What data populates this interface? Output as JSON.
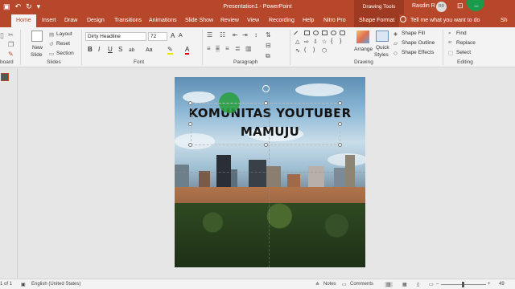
{
  "window": {
    "title": "Presentation1 - PowerPoint",
    "context_label": "Drawing Tools",
    "user_name": "Rasdin R",
    "avatar_initials": "RR",
    "accent": "#b7472a"
  },
  "tabs": [
    "Home",
    "Insert",
    "Draw",
    "Design",
    "Transitions",
    "Animations",
    "Slide Show",
    "Review",
    "View",
    "Recording",
    "Help",
    "Nitro Pro",
    "Shape Format"
  ],
  "tell_me": "Tell me what you want to do",
  "share": "Sh",
  "ribbon": {
    "clipboard_label": "board",
    "slides": {
      "new_slide": "New",
      "new_slide_2": "Slide",
      "layout": "Layout",
      "reset": "Reset",
      "section": "Section",
      "label": "Slides"
    },
    "font": {
      "name": "Dirty Headline",
      "size": "72",
      "label": "Font",
      "bold": "B",
      "italic": "I",
      "underline": "U",
      "strike": "S",
      "spacing": "ab",
      "case": "Aa"
    },
    "paragraph": {
      "label": "Paragraph"
    },
    "drawing": {
      "arrange": "Arrange",
      "quick_styles": "Quick",
      "quick_styles_2": "Styles",
      "shape_fill": "Shape Fill",
      "shape_outline": "Shape Outline",
      "shape_effects": "Shape Effects",
      "label": "Drawing"
    },
    "editing": {
      "find": "Find",
      "replace": "Replace",
      "select": "Select",
      "label": "Editing"
    }
  },
  "slide": {
    "number": "1",
    "title_line1": "KOMUNITAS YOUTUBER",
    "title_line2": "MAMUJU"
  },
  "status": {
    "slide_of": "1 of 1",
    "language": "English (United States)",
    "notes": "Notes",
    "comments": "Comments",
    "zoom": "49"
  }
}
